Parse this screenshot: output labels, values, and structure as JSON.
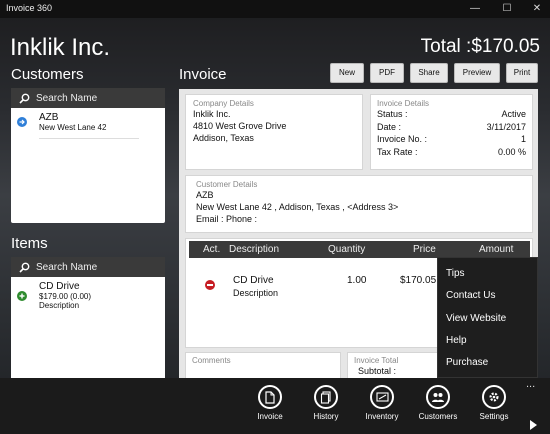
{
  "window": {
    "title": "Invoice 360",
    "minimize": "—",
    "maximize": "☐",
    "close": "✕"
  },
  "header": {
    "company": "Inklik Inc.",
    "total": "Total :$170.05"
  },
  "customers": {
    "heading": "Customers",
    "search_placeholder": "Search Name",
    "items": [
      {
        "name": "AZB",
        "address": "New West Lane 42"
      }
    ]
  },
  "items": {
    "heading": "Items",
    "search_placeholder": "Search Name",
    "list": [
      {
        "name": "CD Drive",
        "price": "$179.00 (0.00)",
        "description": "Description"
      }
    ]
  },
  "invoice": {
    "heading": "Invoice",
    "toolbar": {
      "new": "New",
      "pdf": "PDF",
      "share": "Share",
      "preview": "Preview",
      "print": "Print"
    },
    "company_details": {
      "label": "Company Details",
      "name": "Inklik Inc.",
      "street": "4810 West Grove Drive",
      "city": "Addison, Texas"
    },
    "invoice_details": {
      "label": "Invoice Details",
      "rows": [
        {
          "key": "Status :",
          "value": "Active"
        },
        {
          "key": "Date :",
          "value": "3/11/2017"
        },
        {
          "key": "Invoice No. :",
          "value": "1"
        },
        {
          "key": "Tax Rate :",
          "value": "0.00 %"
        }
      ]
    },
    "customer_details": {
      "label": "Customer Details",
      "name": "AZB",
      "address": "New West Lane 42  ,  Addison, Texas  ,  <Address 3>",
      "contact": "Email :    Phone :"
    },
    "table": {
      "headers": {
        "act": "Act.",
        "description": "Description",
        "quantity": "Quantity",
        "price": "Price",
        "amount": "Amount"
      },
      "rows": [
        {
          "name": "CD Drive",
          "description": "Description",
          "quantity": "1.00",
          "price": "$170.05"
        }
      ]
    },
    "comments_label": "Comments",
    "invoice_total_label": "Invoice Total",
    "subtotal_label": "Subtotal :"
  },
  "context_menu": {
    "items": [
      "Tips",
      "Contact Us",
      "View Website",
      "Help",
      "Purchase"
    ]
  },
  "app_bar": {
    "more": "...",
    "buttons": [
      {
        "label": "Invoice",
        "icon": "document-icon"
      },
      {
        "label": "History",
        "icon": "history-icon"
      },
      {
        "label": "Inventory",
        "icon": "inventory-icon"
      },
      {
        "label": "Customers",
        "icon": "people-icon"
      },
      {
        "label": "Settings",
        "icon": "gear-icon"
      }
    ]
  }
}
